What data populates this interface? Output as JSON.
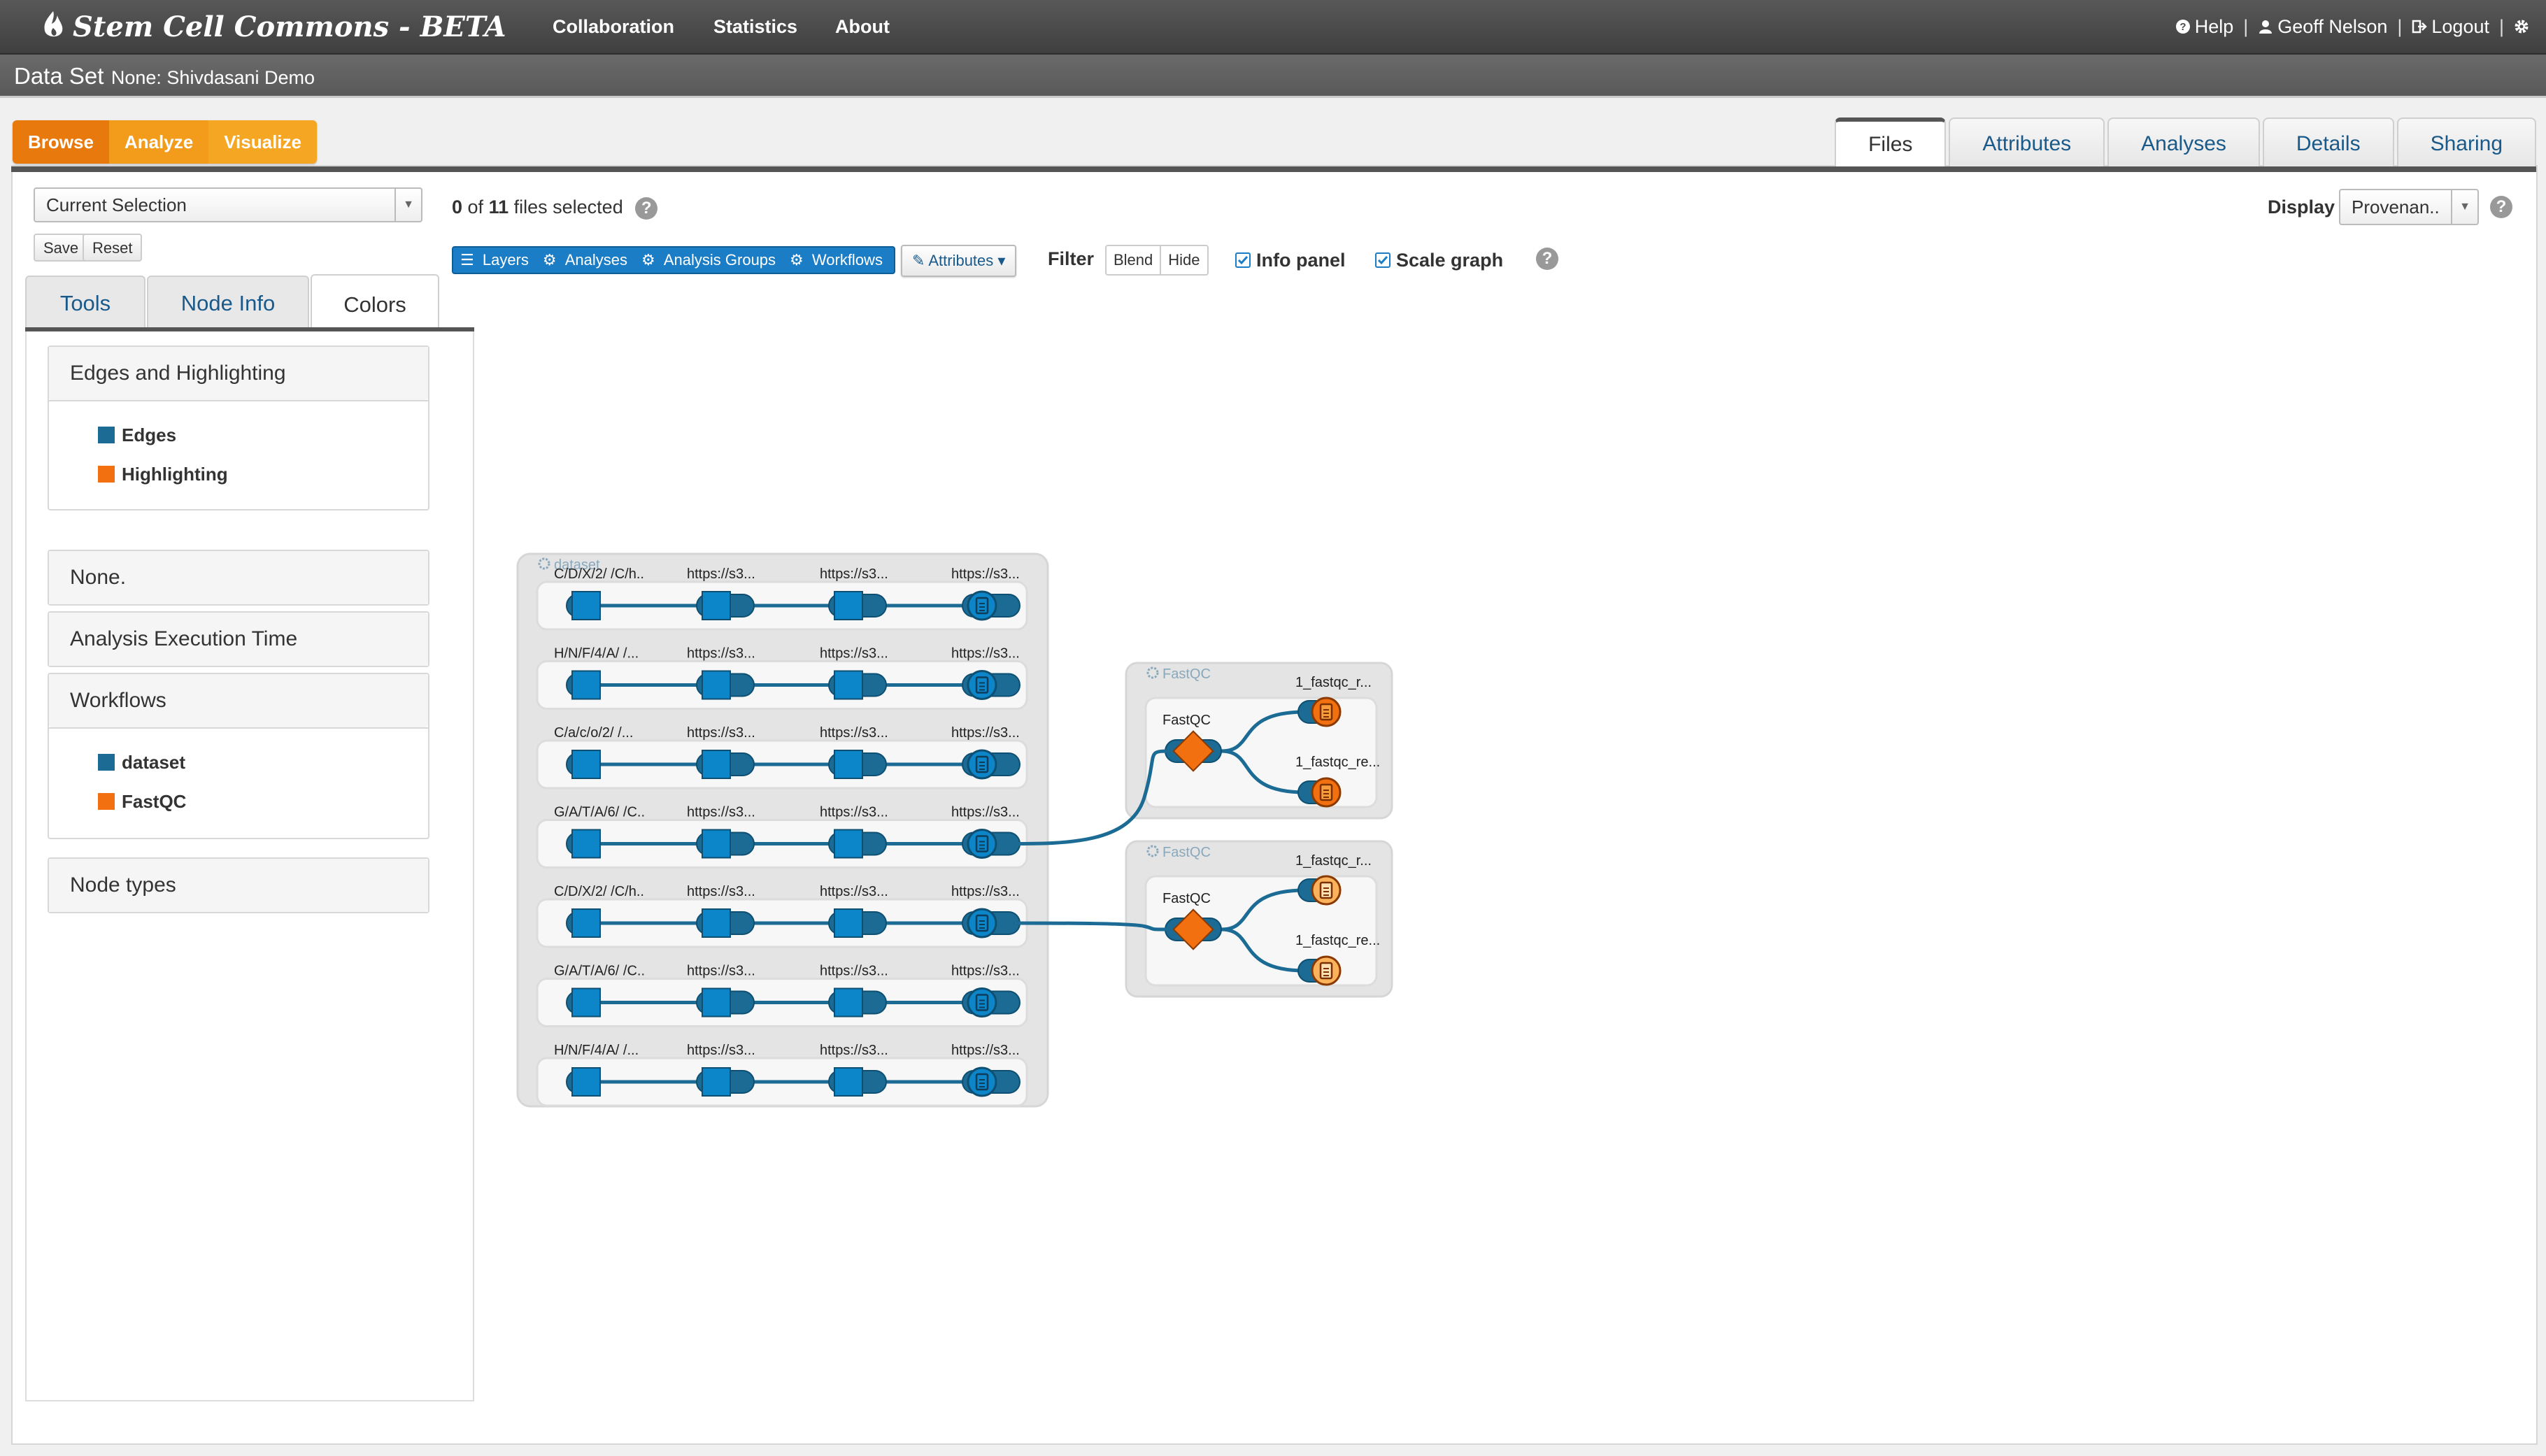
{
  "app": {
    "brand": "Stem Cell Commons - BETA",
    "nav": [
      "Collaboration",
      "Statistics",
      "About"
    ],
    "help_label": "Help",
    "user_name": "Geoff Nelson",
    "logout_label": "Logout"
  },
  "dataset": {
    "label": "Data Set",
    "name": "None: Shivdasani Demo"
  },
  "modes": [
    "Browse",
    "Analyze",
    "Visualize"
  ],
  "right_tabs": [
    "Files",
    "Attributes",
    "Analyses",
    "Details",
    "Sharing"
  ],
  "selection": {
    "current": "Current Selection",
    "save": "Save",
    "reset": "Reset",
    "count_selected": "0",
    "count_total": "11",
    "count_suffix": "files selected"
  },
  "left_tabs": [
    "Tools",
    "Node Info",
    "Colors"
  ],
  "colors_panel": {
    "edges_title": "Edges and Highlighting",
    "edges_items": [
      {
        "label": "Edges",
        "color": "#1b6b94"
      },
      {
        "label": "Highlighting",
        "color": "#f2700f"
      }
    ],
    "none_title": "None.",
    "time_title": "Analysis Execution Time",
    "workflows_title": "Workflows",
    "workflow_items": [
      {
        "label": "dataset",
        "color": "#1b6b94"
      },
      {
        "label": "FastQC",
        "color": "#f2700f"
      }
    ],
    "nodetypes_title": "Node types"
  },
  "toolbar": {
    "layers": "Layers",
    "analyses": "Analyses",
    "analysis_groups": "Analysis Groups",
    "workflows": "Workflows",
    "attributes": "Attributes",
    "filter": "Filter",
    "blend": "Blend",
    "hide": "Hide",
    "info_panel": "Info panel",
    "scale_graph": "Scale graph",
    "display_label": "Display",
    "display_value": "Provenan.."
  },
  "graph": {
    "dataset_label": "dataset",
    "row_labels": [
      [
        "C/D/X/2/ /C/h..",
        "https://s3...",
        "https://s3...",
        "https://s3..."
      ],
      [
        "H/N/F/4/A/ /...",
        "https://s3...",
        "https://s3...",
        "https://s3..."
      ],
      [
        "C/a/c/o/2/ /...",
        "https://s3...",
        "https://s3...",
        "https://s3..."
      ],
      [
        "G/A/T/A/6/ /C..",
        "https://s3...",
        "https://s3...",
        "https://s3..."
      ],
      [
        "C/D/X/2/ /C/h..",
        "https://s3...",
        "https://s3...",
        "https://s3..."
      ],
      [
        "G/A/T/A/6/ /C..",
        "https://s3...",
        "https://s3...",
        "https://s3..."
      ],
      [
        "H/N/F/4/A/ /...",
        "https://s3...",
        "https://s3...",
        "https://s3..."
      ]
    ],
    "analyses": [
      {
        "group_label": "FastQC",
        "node_label": "FastQC",
        "out1": "1_fastqc_r...",
        "out2": "1_fastqc_re...",
        "source_row": 3
      },
      {
        "group_label": "FastQC",
        "node_label": "FastQC",
        "out1": "1_fastqc_r...",
        "out2": "1_fastqc_re...",
        "source_row": 4
      }
    ]
  }
}
